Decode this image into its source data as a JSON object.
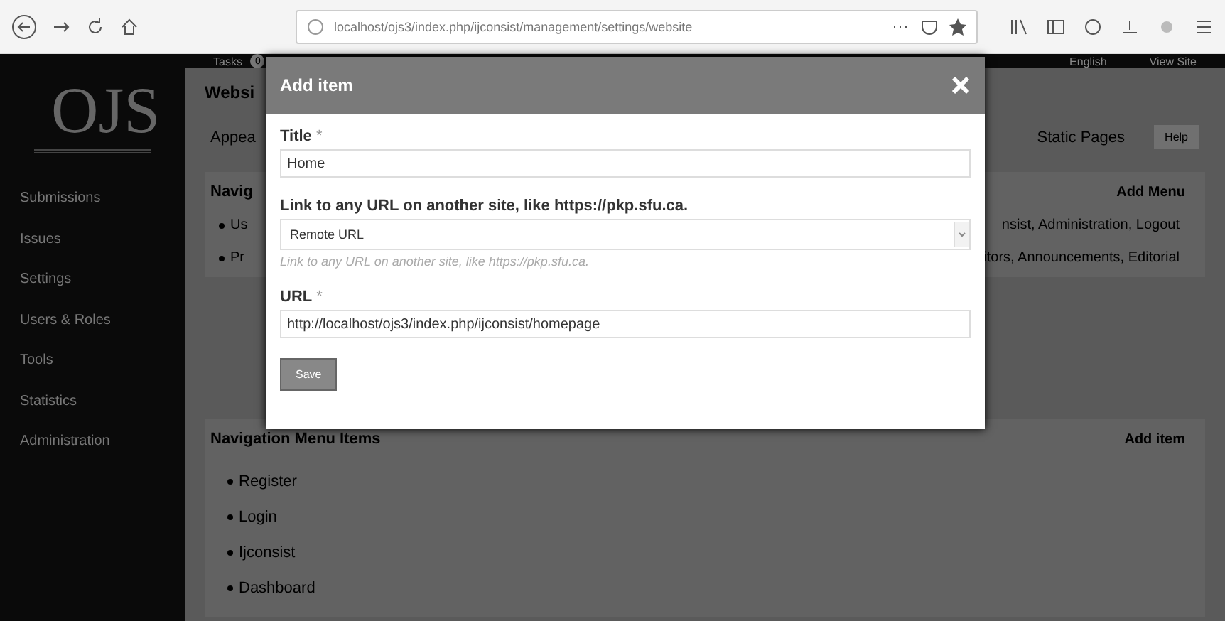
{
  "browser": {
    "url": "localhost/ojs3/index.php/ijconsist/management/settings/website"
  },
  "topbar": {
    "tasks_label": "Tasks",
    "tasks_count": "0",
    "links": [
      "English",
      "View Site"
    ]
  },
  "sidebar": {
    "logo": "OJS",
    "items": [
      {
        "label": "Submissions"
      },
      {
        "label": "Issues"
      },
      {
        "label": "Settings"
      },
      {
        "label": "Users & Roles"
      },
      {
        "label": "Tools"
      },
      {
        "label": "Statistics"
      },
      {
        "label": "Administration"
      }
    ]
  },
  "page": {
    "title_fragment": "Websi",
    "tabs_left_fragment": "Appea",
    "tab_right": "Static Pages",
    "help": "Help",
    "menus_panel": {
      "title_fragment": "Navig",
      "add_button": "Add Menu",
      "rows": [
        {
          "left": "Us",
          "right": "nsist, Administration, Logout"
        },
        {
          "left": "Pr",
          "right": "itors, Announcements, Editorial"
        }
      ]
    },
    "items_panel": {
      "title": "Navigation Menu Items",
      "add_button": "Add item",
      "items": [
        "Register",
        "Login",
        "Ijconsist",
        "Dashboard"
      ]
    }
  },
  "modal": {
    "title": "Add item",
    "fields": [
      {
        "kind": "text",
        "label": "Title",
        "required": true,
        "value": "Home"
      },
      {
        "kind": "select",
        "label": "Link to any URL on another site, like https://pkp.sfu.ca.",
        "required": false,
        "value": "Remote URL",
        "help": "Link to any URL on another site, like https://pkp.sfu.ca."
      },
      {
        "kind": "text",
        "label": "URL",
        "required": true,
        "value": "http://localhost/ojs3/index.php/ijconsist/homepage"
      }
    ],
    "required_mark": "*",
    "save": "Save"
  }
}
